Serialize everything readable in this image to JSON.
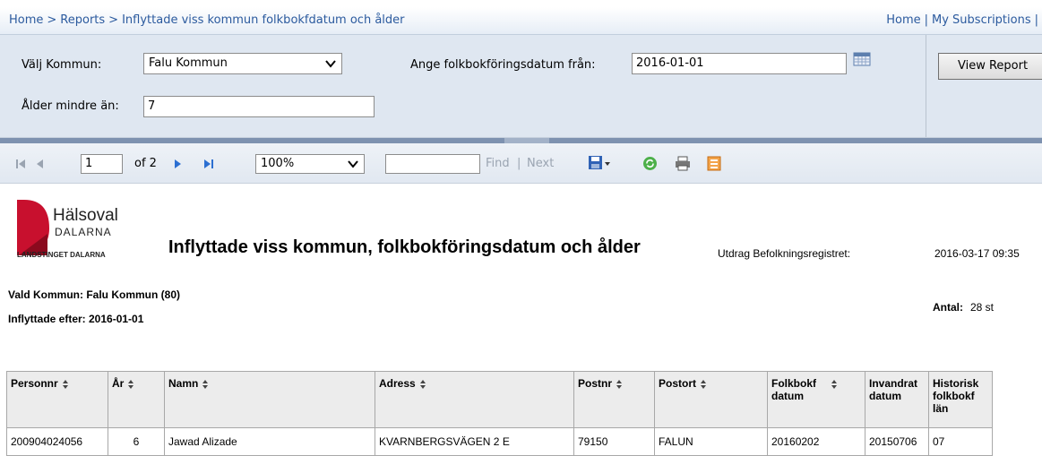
{
  "breadcrumb": {
    "items": [
      "Home",
      "Reports",
      "Inflyttade viss kommun folkbokfdatum och ålder"
    ],
    "separator": ">"
  },
  "top_links": [
    "Home",
    "My Subscriptions"
  ],
  "parameters": {
    "kommun_label": "Välj Kommun:",
    "kommun_value": "Falu Kommun",
    "date_label": "Ange folkbokföringsdatum från:",
    "date_value": "2016-01-01",
    "age_label": "Ålder mindre än:",
    "age_value": "7",
    "view_button": "View Report"
  },
  "toolbar": {
    "page_value": "1",
    "page_of": "of 2",
    "zoom": "100%",
    "find_label": "Find",
    "find_sep": "|",
    "next_label": "Next"
  },
  "report": {
    "logo_line1": "Hälsoval",
    "logo_line2": "DALARNA",
    "logo_line3": "LANDSTINGET DALARNA",
    "title": "Inflyttade viss kommun, folkbokföringsdatum och ålder",
    "extract_label": "Utdrag Befolkningsregistret:",
    "extract_value": "2016-03-17 09:35",
    "vald_kommun": "Vald Kommun: Falu Kommun (80)",
    "inflyttade_efter": "Inflyttade efter: 2016-01-01",
    "antal_label": "Antal:",
    "antal_value": "28 st"
  },
  "table": {
    "headers": [
      "Personnr",
      "År",
      "Namn",
      "Adress",
      "Postnr",
      "Postort",
      "Folkbokf datum",
      "Invandrat datum",
      "Historisk folkbokf län"
    ],
    "rows": [
      [
        "200904024056",
        "6",
        "Jawad Alizade",
        "KVARNBERGSVÄGEN 2 E",
        "79150",
        "FALUN",
        "20160202",
        "20150706",
        "07"
      ]
    ]
  },
  "colors": {
    "link": "#2b5a9e",
    "param_bg": "#dfe7f1",
    "logo_red": "#c8102e"
  }
}
